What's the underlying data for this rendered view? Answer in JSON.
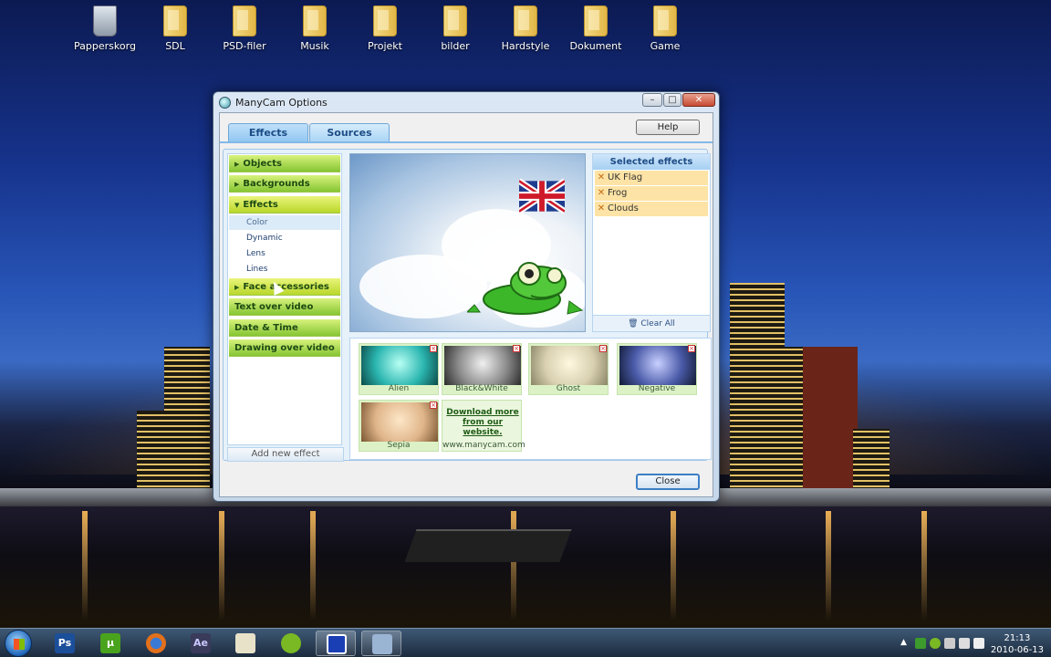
{
  "desktop": {
    "icons": [
      {
        "label": "Papperskorg",
        "type": "recycle-bin"
      },
      {
        "label": "SDL",
        "type": "folder"
      },
      {
        "label": "PSD-filer",
        "type": "folder"
      },
      {
        "label": "Musik",
        "type": "folder"
      },
      {
        "label": "Projekt",
        "type": "folder"
      },
      {
        "label": "bilder",
        "type": "folder"
      },
      {
        "label": "Hardstyle",
        "type": "folder"
      },
      {
        "label": "Dokument",
        "type": "folder"
      },
      {
        "label": "Game",
        "type": "folder"
      }
    ]
  },
  "window": {
    "title": "ManyCam Options",
    "buttons": {
      "minimize": "–",
      "maximize": "□",
      "close": "✕"
    }
  },
  "tabs": [
    {
      "label": "Effects",
      "active": true
    },
    {
      "label": "Sources",
      "active": false
    }
  ],
  "help_label": "Help",
  "nav": {
    "items": [
      {
        "label": "Objects",
        "state": "collapsed"
      },
      {
        "label": "Backgrounds",
        "state": "collapsed"
      },
      {
        "label": "Effects",
        "state": "expanded"
      },
      {
        "label": "Face accessories",
        "state": "collapsed"
      },
      {
        "label": "Text over video",
        "state": "none"
      },
      {
        "label": "Date & Time",
        "state": "none"
      },
      {
        "label": "Drawing over video",
        "state": "none"
      }
    ],
    "subitems": [
      "Color",
      "Dynamic",
      "Lens",
      "Lines"
    ],
    "selected_subitem": "Color",
    "add_label": "Add new effect"
  },
  "selected_effects": {
    "title": "Selected effects",
    "items": [
      "UK Flag",
      "Frog",
      "Clouds"
    ],
    "clear_label": "Clear All"
  },
  "effect_thumbs": [
    {
      "label": "Alien",
      "tint": "#2bb6b0"
    },
    {
      "label": "Black&White",
      "tint": "#8c8c8c"
    },
    {
      "label": "Ghost",
      "tint": "#d8d0b0"
    },
    {
      "label": "Negative",
      "tint": "#4a5aa8"
    },
    {
      "label": "Sepia",
      "tint": "#e0b58a"
    }
  ],
  "download": {
    "line1": "Download more",
    "line2": "from our website.",
    "url": "www.manycam.com"
  },
  "close_label": "Close",
  "taskbar": {
    "apps": [
      {
        "name": "photoshop",
        "text": "Ps",
        "color": "#1c4f9a"
      },
      {
        "name": "utorrent",
        "text": "µ",
        "color": "#4aa31d"
      },
      {
        "name": "firefox",
        "text": "",
        "color": "#e3701a"
      },
      {
        "name": "after-effects",
        "text": "Ae",
        "color": "#3a3a5a"
      },
      {
        "name": "notepad",
        "text": "",
        "color": "#e8e2c8"
      },
      {
        "name": "spotify",
        "text": "",
        "color": "#7ab824"
      },
      {
        "name": "manycam-app",
        "text": "",
        "color": "#1a3fb4"
      },
      {
        "name": "control-panel",
        "text": "",
        "color": "#9ab4d4"
      }
    ],
    "time": "21:13",
    "date": "2010-06-13"
  }
}
